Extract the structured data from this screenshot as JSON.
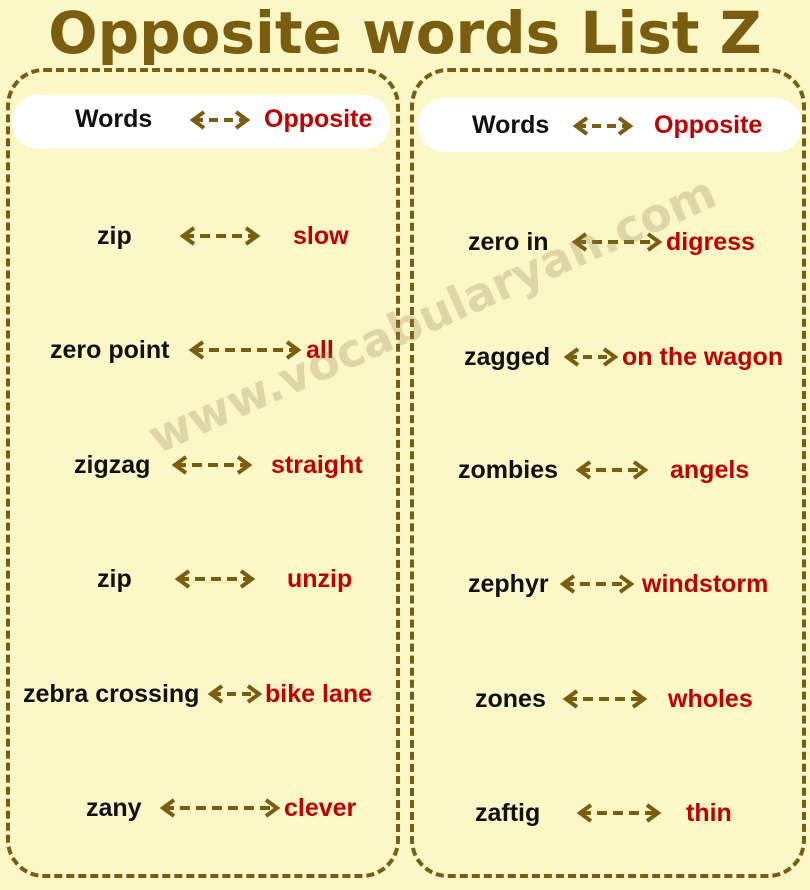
{
  "title": "Opposite words List Z",
  "header": {
    "words": "Words",
    "opposite": "Opposite"
  },
  "watermark": "www.vocabularyan.com",
  "colors": {
    "accent": "#7a5d0f",
    "opposite": "#c00000",
    "background": "#fbf7c7"
  },
  "left": [
    {
      "word": "zip",
      "opposite": "slow"
    },
    {
      "word": "zero point",
      "opposite": "all"
    },
    {
      "word": "zigzag",
      "opposite": "straight"
    },
    {
      "word": "zip",
      "opposite": "unzip"
    },
    {
      "word": "zebra crossing",
      "opposite": "bike lane"
    },
    {
      "word": "zany",
      "opposite": "clever"
    }
  ],
  "right": [
    {
      "word": "zero in",
      "opposite": "digress"
    },
    {
      "word": "zagged",
      "opposite": "on the wagon"
    },
    {
      "word": "zombies",
      "opposite": "angels"
    },
    {
      "word": "zephyr",
      "opposite": "windstorm"
    },
    {
      "word": "zones",
      "opposite": "wholes"
    },
    {
      "word": "zaftig",
      "opposite": "thin"
    }
  ]
}
